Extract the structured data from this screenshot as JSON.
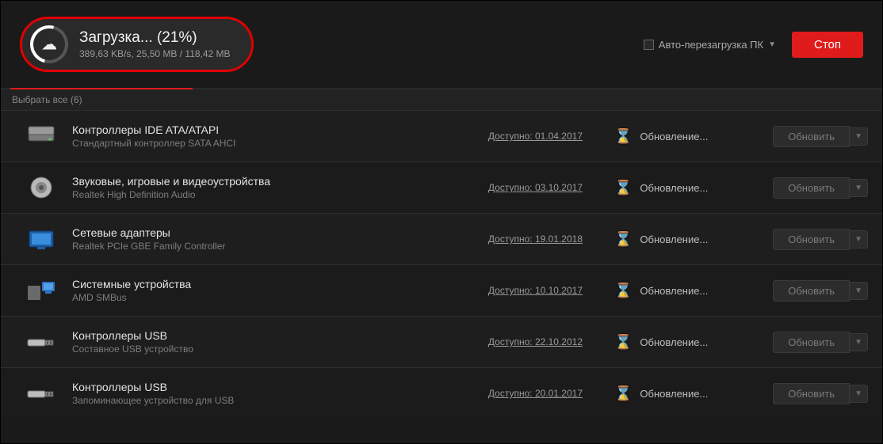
{
  "header": {
    "download_title": "Загрузка... (21%)",
    "download_sub": "389,63 KB/s, 25,50 MB / 118,42 MB",
    "auto_reboot_label": "Авто-перезагрузка ПК",
    "stop_label": "Стоп"
  },
  "select_all": "Выбрать все (6)",
  "columns": {
    "available_prefix": "Доступно:",
    "status_updating": "Обновление...",
    "update_btn": "Обновить"
  },
  "drivers": [
    {
      "name": "Контроллеры IDE ATA/ATAPI",
      "sub": "Стандартный контроллер SATA AHCI",
      "date": "01.04.2017",
      "icon": "hdd"
    },
    {
      "name": "Звуковые, игровые и видеоустройства",
      "sub": "Realtek High Definition Audio",
      "date": "03.10.2017",
      "icon": "speaker"
    },
    {
      "name": "Сетевые адаптеры",
      "sub": "Realtek PCIe GBE Family Controller",
      "date": "19.01.2018",
      "icon": "network"
    },
    {
      "name": "Системные устройства",
      "sub": "AMD SMBus",
      "date": "10.10.2017",
      "icon": "system"
    },
    {
      "name": "Контроллеры USB",
      "sub": "Составное USB устройство",
      "date": "22.10.2012",
      "icon": "usb"
    },
    {
      "name": "Контроллеры USB",
      "sub": "Запоминающее устройство для USB",
      "date": "20.01.2017",
      "icon": "usb"
    }
  ]
}
